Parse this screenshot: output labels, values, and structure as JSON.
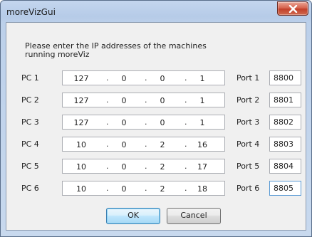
{
  "window": {
    "title": "moreVizGui",
    "close_icon": "close-icon"
  },
  "instructions": "Please enter the IP addresses of the machines running moreViz",
  "machines": [
    {
      "label": "PC 1",
      "ip": [
        "127",
        "0",
        "0",
        "1"
      ],
      "port_label": "Port 1",
      "port": "8800"
    },
    {
      "label": "PC 2",
      "ip": [
        "127",
        "0",
        "0",
        "1"
      ],
      "port_label": "Port 2",
      "port": "8801"
    },
    {
      "label": "PC 3",
      "ip": [
        "127",
        "0",
        "0",
        "1"
      ],
      "port_label": "Port 3",
      "port": "8802"
    },
    {
      "label": "PC 4",
      "ip": [
        "10",
        "0",
        "2",
        "16"
      ],
      "port_label": "Port 4",
      "port": "8803"
    },
    {
      "label": "PC 5",
      "ip": [
        "10",
        "0",
        "2",
        "17"
      ],
      "port_label": "Port 5",
      "port": "8804"
    },
    {
      "label": "PC 6",
      "ip": [
        "10",
        "0",
        "2",
        "18"
      ],
      "port_label": "Port 6",
      "port": "8805"
    }
  ],
  "ip_separator": ".",
  "buttons": {
    "ok": "OK",
    "cancel": "Cancel"
  }
}
